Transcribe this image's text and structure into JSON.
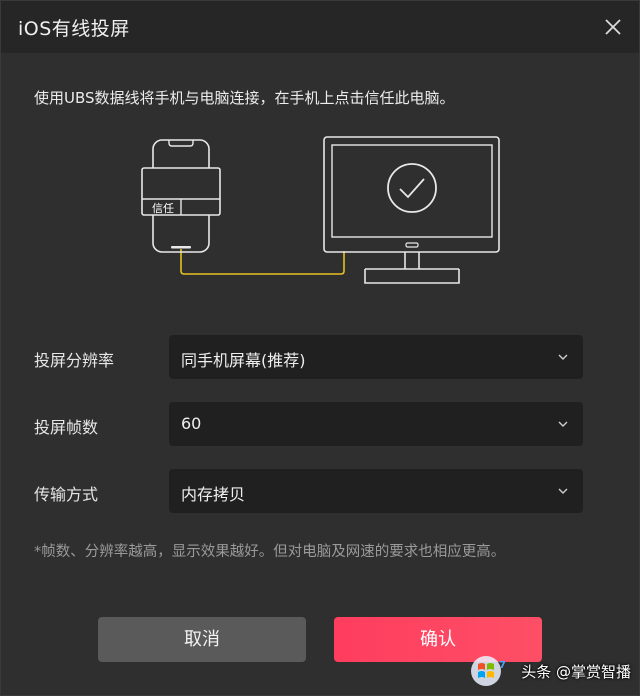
{
  "window": {
    "title": "iOS有线投屏"
  },
  "instruction": "使用UBS数据线将手机与电脑连接，在手机上点击信任此电脑。",
  "illustration": {
    "trust_label": "信任"
  },
  "settings": {
    "resolution": {
      "label": "投屏分辨率",
      "value": "同手机屏幕(推荐)"
    },
    "framerate": {
      "label": "投屏帧数",
      "value": "60"
    },
    "transfer": {
      "label": "传输方式",
      "value": "内存拷贝"
    }
  },
  "note": "*帧数、分辨率越高，显示效果越好。但对电脑及网速的要求也相应更高。",
  "buttons": {
    "cancel": "取消",
    "confirm": "确认"
  },
  "watermark": {
    "text": "头条 @掌赏智播"
  },
  "colors": {
    "accent": "#ff3d5e",
    "cable": "#e6c020",
    "background": "#2f2f2f"
  },
  "icons": {
    "close": "close-icon",
    "chevron": "chevron-down-icon",
    "check": "check-circle-icon"
  }
}
